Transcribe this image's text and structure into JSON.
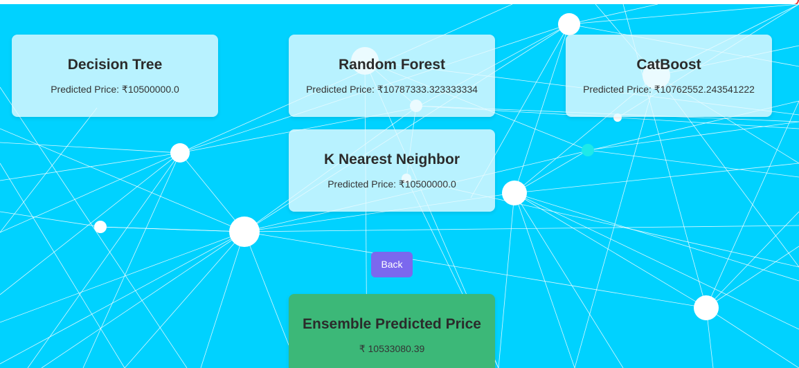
{
  "colors": {
    "background": "#00d2ff",
    "card": "#e6faff",
    "ensemble_card": "#3cb878",
    "back_button": "#7b68ee",
    "network_line": "#ffffff",
    "network_node": "#ffffff",
    "accent_node": "#1de9e9"
  },
  "models": [
    {
      "title": "Decision Tree",
      "price_text": "Predicted Price: ₹10500000.0"
    },
    {
      "title": "Random Forest",
      "price_text": "Predicted Price: ₹10787333.323333334"
    },
    {
      "title": "CatBoost",
      "price_text": "Predicted Price: ₹10762552.243541222"
    },
    {
      "title": "K Nearest Neighbor",
      "price_text": "Predicted Price: ₹10500000.0"
    }
  ],
  "back_label": "Back",
  "ensemble": {
    "title": "Ensemble Predicted Price",
    "price_text": "₹ 10533080.39"
  }
}
